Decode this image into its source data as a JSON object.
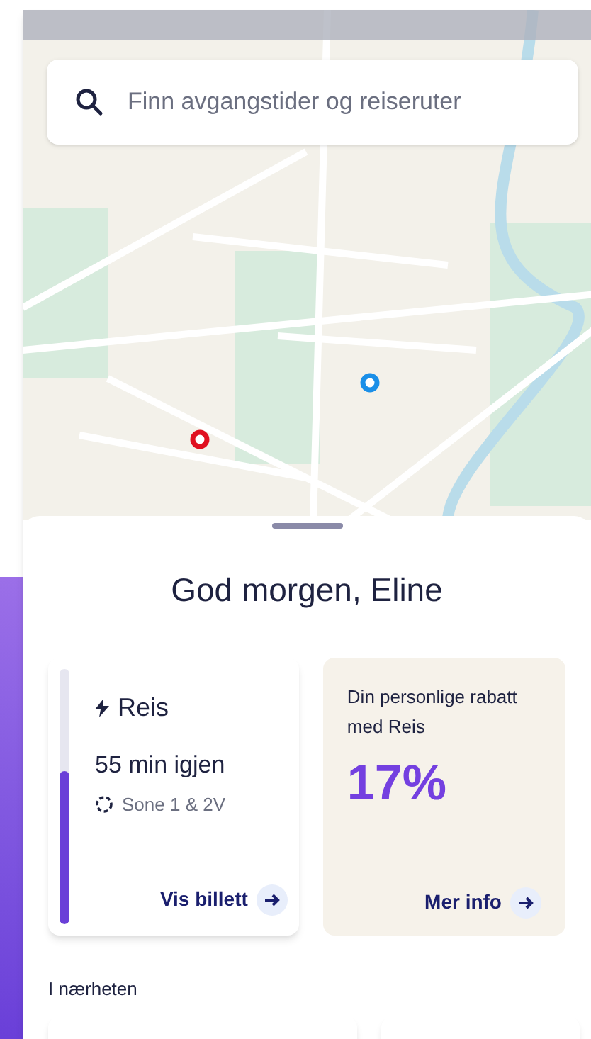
{
  "search": {
    "placeholder": "Finn avgangstider og reiseruter"
  },
  "greeting": "God morgen, Eline",
  "ticket": {
    "title": "Reis",
    "remaining": "55 min igjen",
    "zone": "Sone 1 & 2V",
    "level": 0.6,
    "action": "Vis billett"
  },
  "discount": {
    "text": "Din personlige rabatt med Reis",
    "value": "17%",
    "action": "Mer info"
  },
  "nearby": {
    "heading": "I nærheten"
  }
}
